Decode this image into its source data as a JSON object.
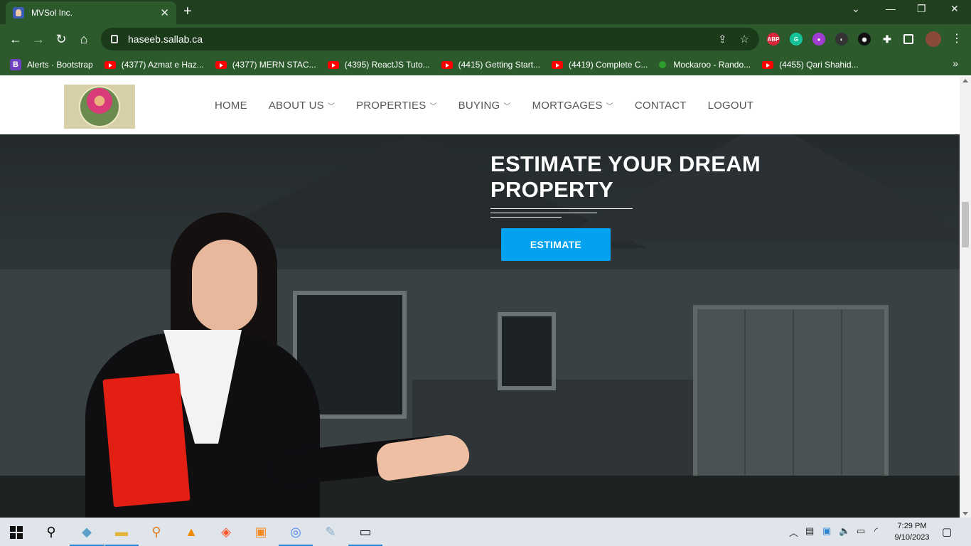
{
  "browser": {
    "tab_title": "MVSol Inc.",
    "tab_close": "✕",
    "new_tab": "+",
    "window_controls": [
      "⌄",
      "—",
      "❐",
      "✕"
    ],
    "url": "haseeb.sallab.ca",
    "ext_abp": "ABP",
    "bookmarks": [
      {
        "label": "Alerts · Bootstrap",
        "icon": "bootstrap-icon"
      },
      {
        "label": "(4377) Azmat e Haz...",
        "icon": "youtube-icon"
      },
      {
        "label": "(4377) MERN STAC...",
        "icon": "youtube-icon"
      },
      {
        "label": "(4395) ReactJS Tuto...",
        "icon": "youtube-icon"
      },
      {
        "label": "(4415) Getting Start...",
        "icon": "youtube-icon"
      },
      {
        "label": "(4419) Complete C...",
        "icon": "youtube-icon"
      },
      {
        "label": "Mockaroo - Rando...",
        "icon": "mockaroo-icon"
      },
      {
        "label": "(4455) Qari Shahid...",
        "icon": "youtube-icon"
      }
    ],
    "bookmarks_more": "»"
  },
  "site": {
    "nav": [
      {
        "label": "HOME",
        "dropdown": false
      },
      {
        "label": "ABOUT US",
        "dropdown": true
      },
      {
        "label": "PROPERTIES",
        "dropdown": true
      },
      {
        "label": "BUYING",
        "dropdown": true
      },
      {
        "label": "MORTGAGES",
        "dropdown": true
      },
      {
        "label": "CONTACT",
        "dropdown": false
      },
      {
        "label": "LOGOUT",
        "dropdown": false
      }
    ],
    "hero": {
      "title_line1": "ESTIMATE YOUR DREAM",
      "title_line2": "PROPERTY",
      "button": "ESTIMATE"
    },
    "colors": {
      "accent": "#02a2f1",
      "chrome": "#2c5a2c"
    }
  },
  "taskbar": {
    "time": "7:29 PM",
    "date": "9/10/2023"
  }
}
